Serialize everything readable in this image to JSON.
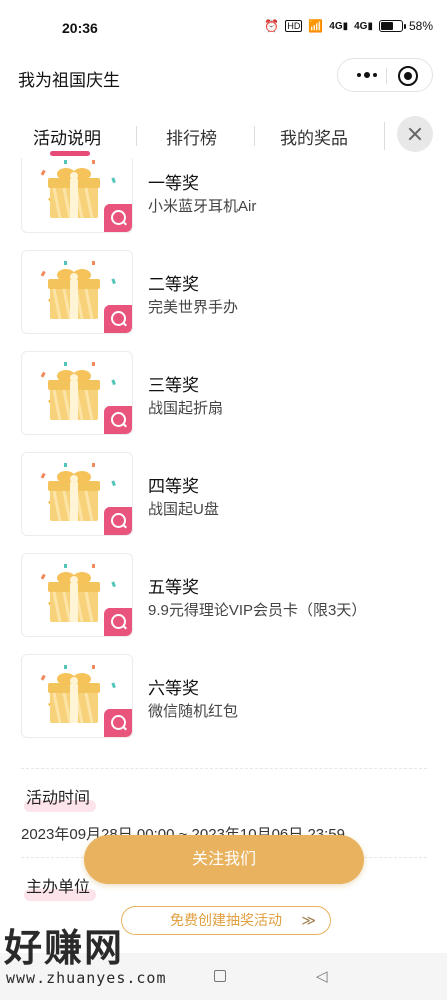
{
  "status_bar": {
    "time": "20:36",
    "icons": [
      "alarm-icon",
      "hd-icon",
      "wifi-icon",
      "signal-4g-icon",
      "signal-4g-icon",
      "battery-icon"
    ],
    "battery_text": "58%",
    "battery_level": 0.58
  },
  "title_bar": {
    "title": "我为祖国庆生"
  },
  "tabs": {
    "items": [
      {
        "label": "活动说明"
      },
      {
        "label": "排行榜"
      },
      {
        "label": "我的奖品"
      }
    ],
    "active_index": 0,
    "accent_color": "#e84a78"
  },
  "prizes": [
    {
      "level": "一等奖",
      "name": "小米蓝牙耳机Air"
    },
    {
      "level": "二等奖",
      "name": "完美世界手办"
    },
    {
      "level": "三等奖",
      "name": "战国起折扇"
    },
    {
      "level": "四等奖",
      "name": "战国起U盘"
    },
    {
      "level": "五等奖",
      "name": "9.9元得理论VIP会员卡（限3天）"
    },
    {
      "level": "六等奖",
      "name": "微信随机红包"
    }
  ],
  "activity_time": {
    "label": "活动时间",
    "value": "2023年09月28日 00:00 ~ 2023年10月06日 23:59"
  },
  "organizer": {
    "label": "主办单位"
  },
  "buttons": {
    "follow": "关注我们",
    "follow_color": "#e8b25e",
    "create": "免费创建抽奖活动",
    "create_chevron": "≫"
  },
  "watermark": {
    "text": "好赚网",
    "url": "www.zhuanyes.com"
  }
}
